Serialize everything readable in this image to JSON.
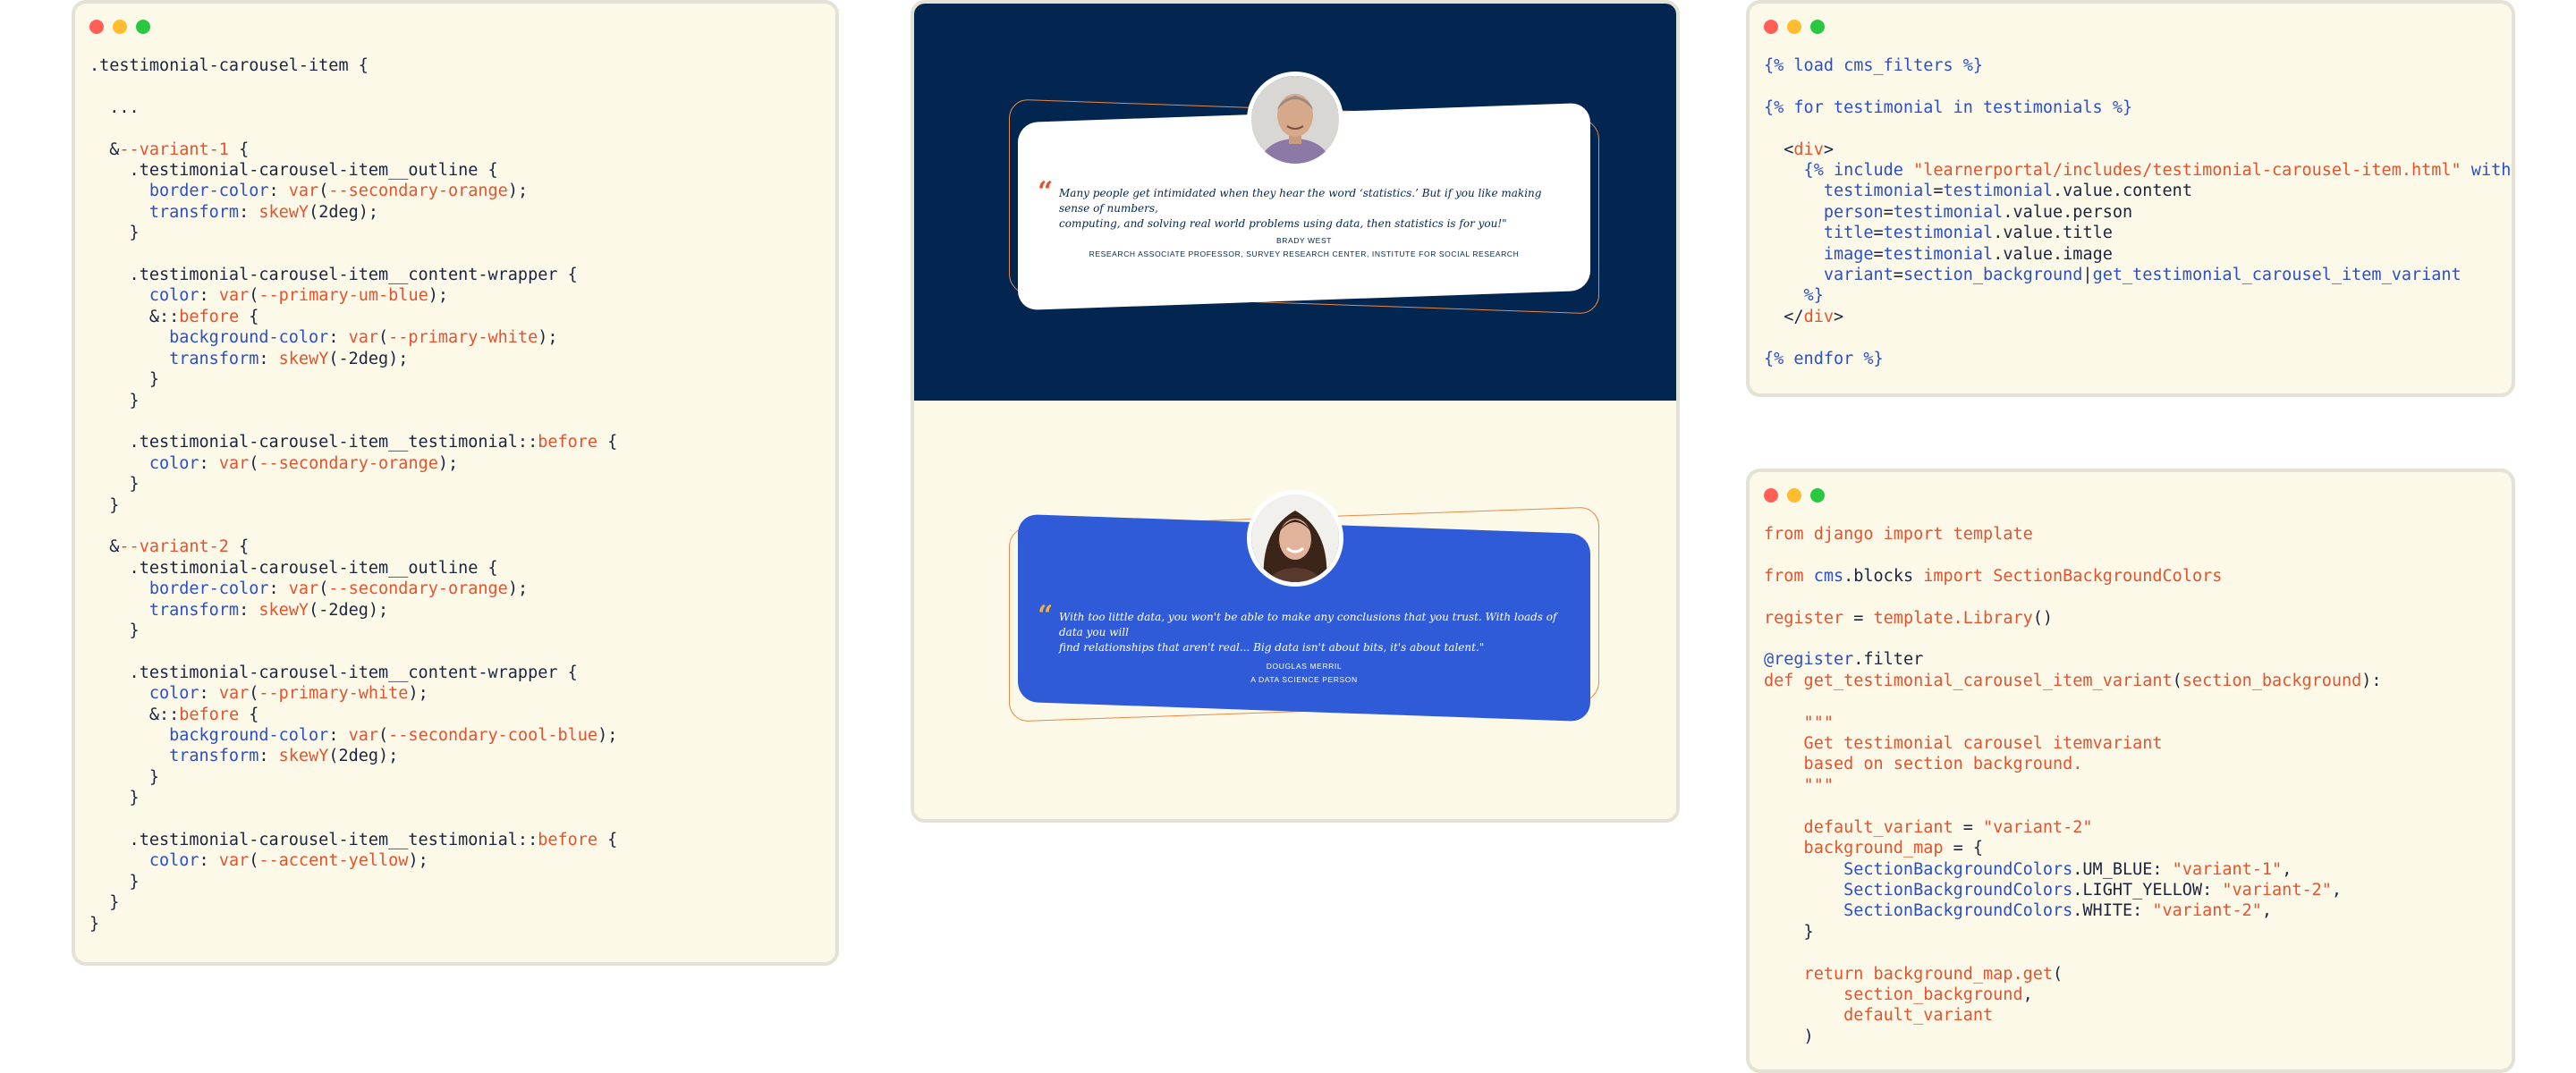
{
  "scss_window": {
    "lines": [
      [
        [
          ".testimonial-carousel-item {",
          "sel"
        ]
      ],
      [
        [
          "",
          ""
        ]
      ],
      [
        [
          "  ...",
          "sel"
        ]
      ],
      [
        [
          "",
          ""
        ]
      ],
      [
        [
          "  &",
          "sel"
        ],
        [
          "--variant-1",
          "kw"
        ],
        [
          " {",
          "sel"
        ]
      ],
      [
        [
          "    .testimonial-carousel-item__outline {",
          "sel"
        ]
      ],
      [
        [
          "      border-color",
          "prop"
        ],
        [
          ": ",
          "sel"
        ],
        [
          "var",
          "fn"
        ],
        [
          "(",
          "sel"
        ],
        [
          "--secondary-orange",
          "str"
        ],
        [
          ");",
          "sel"
        ]
      ],
      [
        [
          "      transform",
          "prop"
        ],
        [
          ": ",
          "sel"
        ],
        [
          "skewY",
          "fn"
        ],
        [
          "(2deg);",
          "sel"
        ]
      ],
      [
        [
          "    }",
          "sel"
        ]
      ],
      [
        [
          "",
          ""
        ]
      ],
      [
        [
          "    .testimonial-carousel-item__content-wrapper {",
          "sel"
        ]
      ],
      [
        [
          "      color",
          "prop"
        ],
        [
          ": ",
          "sel"
        ],
        [
          "var",
          "fn"
        ],
        [
          "(",
          "sel"
        ],
        [
          "--primary-um-blue",
          "str"
        ],
        [
          ");",
          "sel"
        ]
      ],
      [
        [
          "      &::",
          "sel"
        ],
        [
          "before",
          "kw"
        ],
        [
          " {",
          "sel"
        ]
      ],
      [
        [
          "        background-color",
          "prop"
        ],
        [
          ": ",
          "sel"
        ],
        [
          "var",
          "fn"
        ],
        [
          "(",
          "sel"
        ],
        [
          "--primary-white",
          "str"
        ],
        [
          ");",
          "sel"
        ]
      ],
      [
        [
          "        transform",
          "prop"
        ],
        [
          ": ",
          "sel"
        ],
        [
          "skewY",
          "fn"
        ],
        [
          "(-2deg);",
          "sel"
        ]
      ],
      [
        [
          "      }",
          "sel"
        ]
      ],
      [
        [
          "    }",
          "sel"
        ]
      ],
      [
        [
          "",
          ""
        ]
      ],
      [
        [
          "    .testimonial-carousel-item__testimonial::",
          "sel"
        ],
        [
          "before",
          "kw"
        ],
        [
          " {",
          "sel"
        ]
      ],
      [
        [
          "      color",
          "prop"
        ],
        [
          ": ",
          "sel"
        ],
        [
          "var",
          "fn"
        ],
        [
          "(",
          "sel"
        ],
        [
          "--secondary-orange",
          "str"
        ],
        [
          ");",
          "sel"
        ]
      ],
      [
        [
          "    }",
          "sel"
        ]
      ],
      [
        [
          "  }",
          "sel"
        ]
      ],
      [
        [
          "",
          ""
        ]
      ],
      [
        [
          "  &",
          "sel"
        ],
        [
          "--variant-2",
          "kw"
        ],
        [
          " {",
          "sel"
        ]
      ],
      [
        [
          "    .testimonial-carousel-item__outline {",
          "sel"
        ]
      ],
      [
        [
          "      border-color",
          "prop"
        ],
        [
          ": ",
          "sel"
        ],
        [
          "var",
          "fn"
        ],
        [
          "(",
          "sel"
        ],
        [
          "--secondary-orange",
          "str"
        ],
        [
          ");",
          "sel"
        ]
      ],
      [
        [
          "      transform",
          "prop"
        ],
        [
          ": ",
          "sel"
        ],
        [
          "skewY",
          "fn"
        ],
        [
          "(-2deg);",
          "sel"
        ]
      ],
      [
        [
          "    }",
          "sel"
        ]
      ],
      [
        [
          "",
          ""
        ]
      ],
      [
        [
          "    .testimonial-carousel-item__content-wrapper {",
          "sel"
        ]
      ],
      [
        [
          "      color",
          "prop"
        ],
        [
          ": ",
          "sel"
        ],
        [
          "var",
          "fn"
        ],
        [
          "(",
          "sel"
        ],
        [
          "--primary-white",
          "str"
        ],
        [
          ");",
          "sel"
        ]
      ],
      [
        [
          "      &::",
          "sel"
        ],
        [
          "before",
          "kw"
        ],
        [
          " {",
          "sel"
        ]
      ],
      [
        [
          "        background-color",
          "prop"
        ],
        [
          ": ",
          "sel"
        ],
        [
          "var",
          "fn"
        ],
        [
          "(",
          "sel"
        ],
        [
          "--secondary-cool-blue",
          "str"
        ],
        [
          ");",
          "sel"
        ]
      ],
      [
        [
          "        transform",
          "prop"
        ],
        [
          ": ",
          "sel"
        ],
        [
          "skewY",
          "fn"
        ],
        [
          "(2deg);",
          "sel"
        ]
      ],
      [
        [
          "      }",
          "sel"
        ]
      ],
      [
        [
          "    }",
          "sel"
        ]
      ],
      [
        [
          "",
          ""
        ]
      ],
      [
        [
          "    .testimonial-carousel-item__testimonial::",
          "sel"
        ],
        [
          "before",
          "kw"
        ],
        [
          " {",
          "sel"
        ]
      ],
      [
        [
          "      color",
          "prop"
        ],
        [
          ": ",
          "sel"
        ],
        [
          "var",
          "fn"
        ],
        [
          "(",
          "sel"
        ],
        [
          "--accent-yellow",
          "str"
        ],
        [
          ");",
          "sel"
        ]
      ],
      [
        [
          "    }",
          "sel"
        ]
      ],
      [
        [
          "  }",
          "sel"
        ]
      ],
      [
        [
          "}",
          "sel"
        ]
      ]
    ]
  },
  "preview": {
    "colors": {
      "um_blue": "#02264f",
      "light_yellow": "#fcf9e8",
      "cool_blue": "#2f5bd8",
      "orange": "#e5532e",
      "yellow": "#f2b233"
    },
    "testimonial_1": {
      "quote_mark": "“",
      "quote_line1": "Many people get intimidated when they hear the word ‘statistics.’ But if you like making sense of numbers,",
      "quote_line2": "computing, and solving real world problems using data, then statistics is for you!\"",
      "name": "BRADY WEST",
      "title": "RESEARCH ASSOCIATE PROFESSOR, SURVEY RESEARCH CENTER, INSTITUTE FOR SOCIAL RESEARCH",
      "avatar_icon": "man-portrait-icon"
    },
    "testimonial_2": {
      "quote_mark": "“",
      "quote_line1": "With too little data, you won't be able to make any conclusions that you trust. With loads of data you will",
      "quote_line2": "find relationships that aren't real... Big data isn't about bits, it's about talent.\"",
      "name": "DOUGLAS MERRIL",
      "title": "A DATA SCIENCE PERSON",
      "avatar_icon": "woman-portrait-icon"
    }
  },
  "template_window": {
    "lines": [
      [
        [
          "{% load cms_filters %}",
          "blue"
        ]
      ],
      [
        [
          "",
          ""
        ]
      ],
      [
        [
          "{% for testimonial in testimonials %}",
          "blue"
        ]
      ],
      [
        [
          "",
          ""
        ]
      ],
      [
        [
          "  <",
          "plain"
        ],
        [
          "div",
          "kw"
        ],
        [
          ">",
          "plain"
        ]
      ],
      [
        [
          "    {% include ",
          "blue"
        ],
        [
          "\"learnerportal/includes/testimonial-carousel-item.html\"",
          "str"
        ],
        [
          " with",
          "blue"
        ]
      ],
      [
        [
          "      testimonial",
          "blue"
        ],
        [
          "=",
          "plain"
        ],
        [
          "testimonial",
          "blue"
        ],
        [
          ".value.content",
          "plain"
        ]
      ],
      [
        [
          "      person",
          "blue"
        ],
        [
          "=",
          "plain"
        ],
        [
          "testimonial",
          "blue"
        ],
        [
          ".value.person",
          "plain"
        ]
      ],
      [
        [
          "      title",
          "blue"
        ],
        [
          "=",
          "plain"
        ],
        [
          "testimonial",
          "blue"
        ],
        [
          ".value.title",
          "plain"
        ]
      ],
      [
        [
          "      image",
          "blue"
        ],
        [
          "=",
          "plain"
        ],
        [
          "testimonial",
          "blue"
        ],
        [
          ".value.image",
          "plain"
        ]
      ],
      [
        [
          "      variant",
          "blue"
        ],
        [
          "=",
          "plain"
        ],
        [
          "section_background",
          "blue"
        ],
        [
          "|",
          "plain"
        ],
        [
          "get_testimonial_carousel_item_variant",
          "blue"
        ]
      ],
      [
        [
          "    %}",
          "blue"
        ]
      ],
      [
        [
          "  </",
          "plain"
        ],
        [
          "div",
          "kw"
        ],
        [
          ">",
          "plain"
        ]
      ],
      [
        [
          "",
          ""
        ]
      ],
      [
        [
          "{% endfor %}",
          "blue"
        ]
      ]
    ]
  },
  "python_window": {
    "lines": [
      [
        [
          "from django import template",
          "kw"
        ]
      ],
      [
        [
          "",
          ""
        ]
      ],
      [
        [
          "from ",
          "kw"
        ],
        [
          "cms",
          "blue"
        ],
        [
          ".",
          "plain"
        ],
        [
          "blocks",
          "plain"
        ],
        [
          " import SectionBackgroundColors",
          "kw"
        ]
      ],
      [
        [
          "",
          ""
        ]
      ],
      [
        [
          "register",
          "kw"
        ],
        [
          " = ",
          "plain"
        ],
        [
          "template.Library",
          "kw"
        ],
        [
          "()",
          "plain"
        ]
      ],
      [
        [
          "",
          ""
        ]
      ],
      [
        [
          "@register",
          "blue"
        ],
        [
          ".filter",
          "plain"
        ]
      ],
      [
        [
          "def get_testimonial_carousel_item_variant",
          "kw"
        ],
        [
          "(",
          "plain"
        ],
        [
          "section_background",
          "kw"
        ],
        [
          "):",
          "plain"
        ]
      ],
      [
        [
          "",
          ""
        ]
      ],
      [
        [
          "    \"\"\"",
          "kw"
        ]
      ],
      [
        [
          "    Get testimonial carousel itemvariant",
          "kw"
        ]
      ],
      [
        [
          "    based on section background.",
          "kw"
        ]
      ],
      [
        [
          "    \"\"\"",
          "kw"
        ]
      ],
      [
        [
          "",
          ""
        ]
      ],
      [
        [
          "    default_variant",
          "kw"
        ],
        [
          " = ",
          "plain"
        ],
        [
          "\"variant-2\"",
          "str"
        ]
      ],
      [
        [
          "    background_map",
          "kw"
        ],
        [
          " = {",
          "plain"
        ]
      ],
      [
        [
          "        SectionBackgroundColors",
          "blue"
        ],
        [
          ".UM_BLUE: ",
          "plain"
        ],
        [
          "\"variant-1\"",
          "str"
        ],
        [
          ",",
          "plain"
        ]
      ],
      [
        [
          "        SectionBackgroundColors",
          "blue"
        ],
        [
          ".LIGHT_YELLOW: ",
          "plain"
        ],
        [
          "\"variant-2\"",
          "str"
        ],
        [
          ",",
          "plain"
        ]
      ],
      [
        [
          "        SectionBackgroundColors",
          "blue"
        ],
        [
          ".WHITE: ",
          "plain"
        ],
        [
          "\"variant-2\"",
          "str"
        ],
        [
          ",",
          "plain"
        ]
      ],
      [
        [
          "    }",
          "plain"
        ]
      ],
      [
        [
          "",
          ""
        ]
      ],
      [
        [
          "    return background_map.get",
          "kw"
        ],
        [
          "(",
          "plain"
        ]
      ],
      [
        [
          "        section_background",
          "kw"
        ],
        [
          ",",
          "plain"
        ]
      ],
      [
        [
          "        default_variant",
          "kw"
        ]
      ],
      [
        [
          "    )",
          "plain"
        ]
      ]
    ]
  }
}
